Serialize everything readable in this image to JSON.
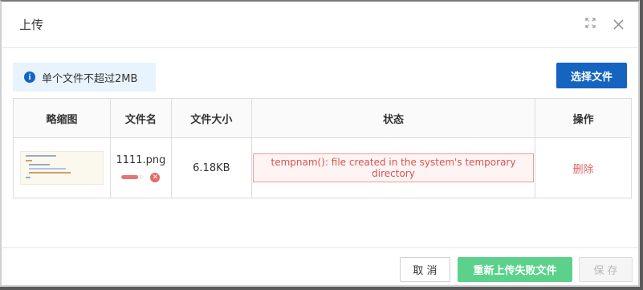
{
  "dialog": {
    "title": "上传"
  },
  "tip": {
    "icon": "info-icon",
    "text": "单个文件不超过2MB"
  },
  "choose_button": "选择文件",
  "table": {
    "headers": [
      "略缩图",
      "文件名",
      "文件大小",
      "状态",
      "操作"
    ],
    "rows": [
      {
        "filename": "1111.png",
        "progress": 0.75,
        "size": "6.18KB",
        "status": "tempnam(): file created in the system's temporary directory",
        "action": "删除"
      }
    ]
  },
  "footer": {
    "cancel": "取 消",
    "reupload": "重新上传失败文件",
    "save": "保 存"
  },
  "colors": {
    "primary": "#1464c0",
    "success": "#5bd18b",
    "danger": "#d9534f"
  }
}
